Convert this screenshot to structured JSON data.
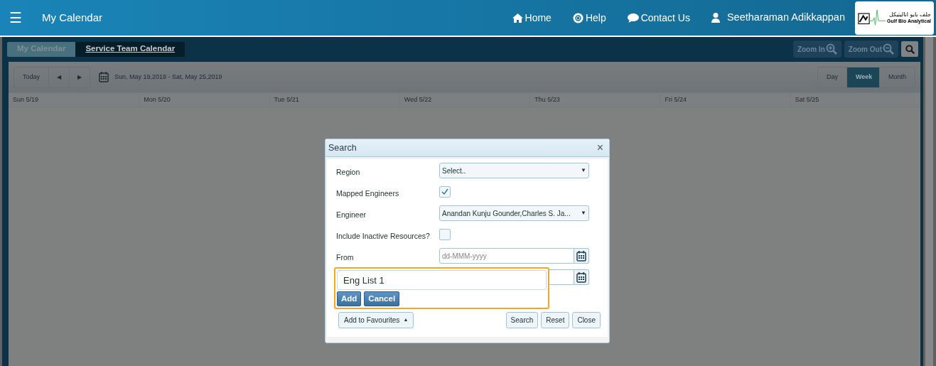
{
  "header": {
    "menu_icon": "☰",
    "title": "My Calendar",
    "nav": [
      {
        "kind": "home",
        "label": "Home"
      },
      {
        "kind": "help",
        "label": "Help"
      },
      {
        "kind": "chat",
        "label": "Contact Us"
      },
      {
        "kind": "user",
        "label": "Seetharaman Adikkappan"
      }
    ],
    "logo": {
      "arabic": "جلف بايو اناليتيكل",
      "name": "Gulf Bio Analytical"
    }
  },
  "tabs": [
    {
      "label": "My Calendar",
      "selected": false
    },
    {
      "label": "Service Team Calendar",
      "selected": true
    }
  ],
  "zoom_buttons": [
    {
      "kind": "in",
      "label": "Zoom In"
    },
    {
      "kind": "out",
      "label": "Zoom Out"
    }
  ],
  "toolbar": {
    "today": "Today",
    "prev": "◀",
    "next": "▶",
    "range": "Sun, May 19,2019 - Sat, May 25,2019",
    "views": [
      {
        "label": "Day",
        "selected": false
      },
      {
        "label": "Week",
        "selected": true
      },
      {
        "label": "Month",
        "selected": false
      }
    ]
  },
  "days": [
    "Sun 5/19",
    "Mon 5/20",
    "Tue 5/21",
    "Wed 5/22",
    "Thu 5/23",
    "Fri 5/24",
    "Sat 5/25"
  ],
  "dialog": {
    "title": "Search",
    "close": "×",
    "fields": [
      {
        "kind": "select",
        "label": "Region",
        "value": "Select..",
        "arrow": "▼"
      },
      {
        "kind": "checkbox",
        "label": "Mapped Engineers",
        "checked": true
      },
      {
        "kind": "select",
        "label": "Engineer",
        "value": "Anandan Kunju Gounder,Charles S. Ja...",
        "arrow": "▼"
      },
      {
        "kind": "checkbox",
        "label": "Include Inactive Resources?",
        "checked": false
      },
      {
        "kind": "date",
        "label": "From",
        "placeholder": "dd-MMM-yyyy"
      },
      {
        "kind": "date"
      }
    ],
    "favourites": "Add to Favourites",
    "favourites_caret": "▲",
    "buttons": [
      "Search",
      "Reset",
      "Close"
    ],
    "popup": {
      "value": "Eng List 1",
      "buttons": [
        "Add",
        "Cancel"
      ]
    }
  }
}
